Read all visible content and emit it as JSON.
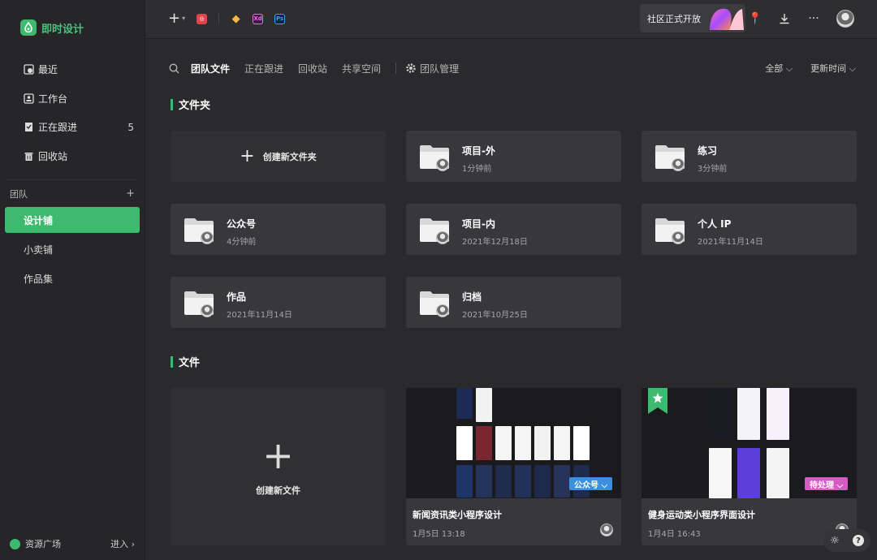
{
  "brand": {
    "name": "即时设计"
  },
  "sidebar": {
    "nav": [
      {
        "label": "最近",
        "icon": "clock-icon",
        "count": ""
      },
      {
        "label": "工作台",
        "icon": "workbench-icon",
        "count": ""
      },
      {
        "label": "正在跟进",
        "icon": "follow-icon",
        "count": "5"
      },
      {
        "label": "回收站",
        "icon": "trash-icon",
        "count": ""
      }
    ],
    "team_header": "团队",
    "team_add": "+",
    "teams": [
      {
        "label": "设计铺",
        "active": true
      },
      {
        "label": "小卖铺",
        "active": false
      },
      {
        "label": "作品集",
        "active": false
      }
    ],
    "bottom": {
      "label": "资源广场",
      "action": "进入 ›"
    }
  },
  "topbar": {
    "add": "+",
    "apps": [
      "figma",
      "sketch",
      "Xd",
      "Ps"
    ],
    "promo": "社区正式开放"
  },
  "subbar": {
    "tabs": [
      "团队文件",
      "正在跟进",
      "回收站",
      "共享空间"
    ],
    "active_tab": "团队文件",
    "manage": "团队管理",
    "filter": "全部",
    "sort": "更新时间"
  },
  "folders_section": {
    "title": "文件夹",
    "create": "创建新文件夹",
    "items": [
      {
        "name": "项目-外",
        "time": "1分钟前"
      },
      {
        "name": "练习",
        "time": "3分钟前"
      },
      {
        "name": "公众号",
        "time": "4分钟前"
      },
      {
        "name": "项目-内",
        "time": "2021年12月18日"
      },
      {
        "name": "个人 IP",
        "time": "2021年11月14日"
      },
      {
        "name": "作品",
        "time": "2021年11月14日"
      },
      {
        "name": "归档",
        "time": "2021年10月25日"
      }
    ]
  },
  "files_section": {
    "title": "文件",
    "create": "创建新文件",
    "items": [
      {
        "name": "新闻资讯类小程序设计",
        "time": "1月5日 13:18",
        "tag": "公众号 ⌵",
        "tag_color": "#3b8fe0",
        "starred": false
      },
      {
        "name": "健身运动类小程序界面设计",
        "time": "1月4日 16:43",
        "tag": "待处理 ⌵",
        "tag_color": "#d65bc2",
        "starred": true
      }
    ]
  },
  "colors": {
    "accent": "#3dba6f",
    "bg": "#2a2a2d",
    "card": "#38383c"
  }
}
